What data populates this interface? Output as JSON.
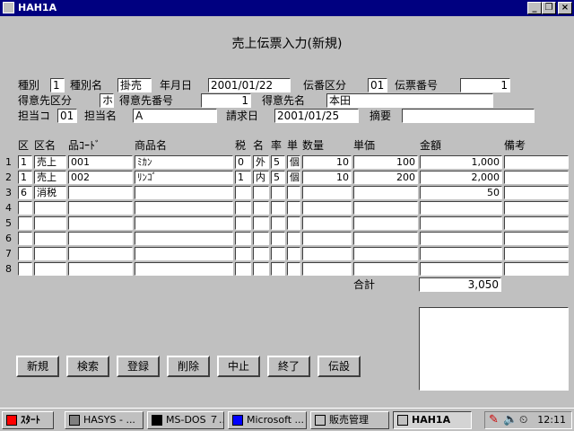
{
  "window": {
    "title": "HAH1A"
  },
  "form": {
    "title": "売上伝票入力(新規)",
    "header": {
      "shubetsu_label": "種別",
      "shubetsu_value": "1",
      "shubetsu_name_label": "種別名",
      "shubetsu_name_value": "掛売",
      "date_label": "年月日",
      "date_value": "2001/01/22",
      "denban_kubun_label": "伝番区分",
      "denban_kubun_value": "01",
      "denpyo_no_label": "伝票番号",
      "denpyo_no_value": "1",
      "tokuisaki_kubun_label": "得意先区分",
      "tokuisaki_kubun_value": "ホ",
      "tokuisaki_no_label": "得意先番号",
      "tokuisaki_no_value": "1",
      "tokuisaki_name_label": "得意先名",
      "tokuisaki_name_value": "本田",
      "tanto_code_label": "担当コ",
      "tanto_code_value": "01",
      "tanto_name_label": "担当名",
      "tanto_name_value": "A",
      "seikyu_date_label": "請求日",
      "seikyu_date_value": "2001/01/25",
      "tekiyo_label": "摘要",
      "tekiyo_value": ""
    },
    "table": {
      "headers": {
        "ku": "区",
        "kumei": "区名",
        "hin_code": "品ｺｰﾄﾞ",
        "shohin_mei": "商品名",
        "zei": "税",
        "mei": "名",
        "ritsu": "率",
        "tan": "単",
        "suryo": "数量",
        "tanka": "単価",
        "kingaku": "金額",
        "biko": "備考"
      },
      "rows": [
        {
          "no": "1",
          "ku": "1",
          "kumei": "売上",
          "hin_code": "001",
          "shohin_mei": "ﾐｶﾝ",
          "zei": "0",
          "mei": "外",
          "ritsu": "5",
          "tan": "個",
          "suryo": "10",
          "tanka": "100",
          "kingaku": "1,000",
          "biko": ""
        },
        {
          "no": "2",
          "ku": "1",
          "kumei": "売上",
          "hin_code": "002",
          "shohin_mei": "ﾘﾝｺﾞ",
          "zei": "1",
          "mei": "内",
          "ritsu": "5",
          "tan": "個",
          "suryo": "10",
          "tanka": "200",
          "kingaku": "2,000",
          "biko": ""
        },
        {
          "no": "3",
          "ku": "6",
          "kumei": "消税",
          "hin_code": "",
          "shohin_mei": "",
          "zei": "",
          "mei": "",
          "ritsu": "",
          "tan": "",
          "suryo": "",
          "tanka": "",
          "kingaku": "50",
          "biko": ""
        },
        {
          "no": "4",
          "ku": "",
          "kumei": "",
          "hin_code": "",
          "shohin_mei": "",
          "zei": "",
          "mei": "",
          "ritsu": "",
          "tan": "",
          "suryo": "",
          "tanka": "",
          "kingaku": "",
          "biko": ""
        },
        {
          "no": "5",
          "ku": "",
          "kumei": "",
          "hin_code": "",
          "shohin_mei": "",
          "zei": "",
          "mei": "",
          "ritsu": "",
          "tan": "",
          "suryo": "",
          "tanka": "",
          "kingaku": "",
          "biko": ""
        },
        {
          "no": "6",
          "ku": "",
          "kumei": "",
          "hin_code": "",
          "shohin_mei": "",
          "zei": "",
          "mei": "",
          "ritsu": "",
          "tan": "",
          "suryo": "",
          "tanka": "",
          "kingaku": "",
          "biko": ""
        },
        {
          "no": "7",
          "ku": "",
          "kumei": "",
          "hin_code": "",
          "shohin_mei": "",
          "zei": "",
          "mei": "",
          "ritsu": "",
          "tan": "",
          "suryo": "",
          "tanka": "",
          "kingaku": "",
          "biko": ""
        },
        {
          "no": "8",
          "ku": "",
          "kumei": "",
          "hin_code": "",
          "shohin_mei": "",
          "zei": "",
          "mei": "",
          "ritsu": "",
          "tan": "",
          "suryo": "",
          "tanka": "",
          "kingaku": "",
          "biko": ""
        }
      ],
      "total_label": "合計",
      "total_value": "3,050"
    },
    "buttons": {
      "new": "新規",
      "search": "検索",
      "register": "登録",
      "delete": "削除",
      "cancel": "中止",
      "exit": "終了",
      "settings": "伝設"
    }
  },
  "taskbar": {
    "start": "ｽﾀｰﾄ",
    "items": [
      {
        "label": "HASYS - ..."
      },
      {
        "label": "MS-DOS ７..."
      },
      {
        "label": "Microsoft ..."
      },
      {
        "label": "販売管理"
      },
      {
        "label": "HAH1A"
      }
    ],
    "clock": "12:11"
  }
}
